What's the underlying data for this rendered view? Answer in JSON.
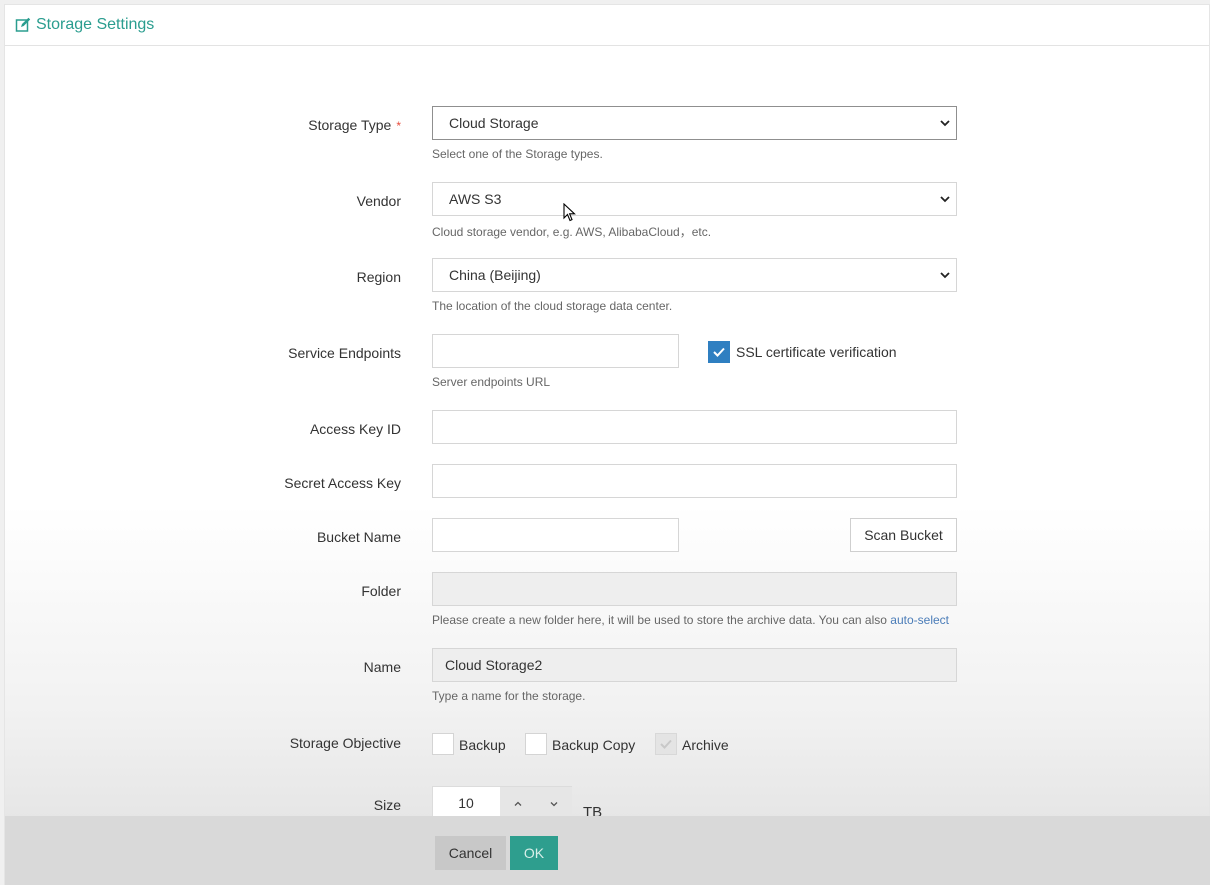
{
  "header": {
    "title": "Storage Settings",
    "icon": "edit-icon",
    "accent": "#2a9d8f"
  },
  "form": {
    "storage_type": {
      "label": "Storage Type",
      "required_mark": "*",
      "value": "Cloud Storage",
      "hint": "Select one of the Storage types."
    },
    "vendor": {
      "label": "Vendor",
      "value": "AWS S3",
      "hint": "Cloud storage vendor, e.g. AWS, AlibabaCloud，etc."
    },
    "region": {
      "label": "Region",
      "value": "China (Beijing)",
      "hint": "The location of the cloud storage data center."
    },
    "service_endpoints": {
      "label": "Service Endpoints",
      "value": "",
      "hint": "Server endpoints URL",
      "ssl_label": "SSL certificate verification",
      "ssl_checked": true
    },
    "access_key_id": {
      "label": "Access Key ID",
      "value": ""
    },
    "secret_access_key": {
      "label": "Secret Access Key",
      "value": ""
    },
    "bucket_name": {
      "label": "Bucket Name",
      "value": "",
      "scan_button": "Scan Bucket"
    },
    "folder": {
      "label": "Folder",
      "value": "",
      "hint": "Please create a new folder here, it will be used to store the archive data. You can also",
      "hint_link": "auto-select"
    },
    "name": {
      "label": "Name",
      "value": "Cloud Storage2",
      "hint": "Type a name for the storage."
    },
    "storage_objective": {
      "label": "Storage Objective",
      "options": [
        {
          "label": "Backup",
          "checked": false
        },
        {
          "label": "Backup Copy",
          "checked": false
        },
        {
          "label": "Archive",
          "checked": true,
          "disabled": true
        }
      ]
    },
    "size": {
      "label": "Size",
      "value": "10",
      "unit": "TB"
    }
  },
  "footer": {
    "cancel_label": "Cancel",
    "ok_label": "OK",
    "ok_color": "#2e9e8e"
  }
}
